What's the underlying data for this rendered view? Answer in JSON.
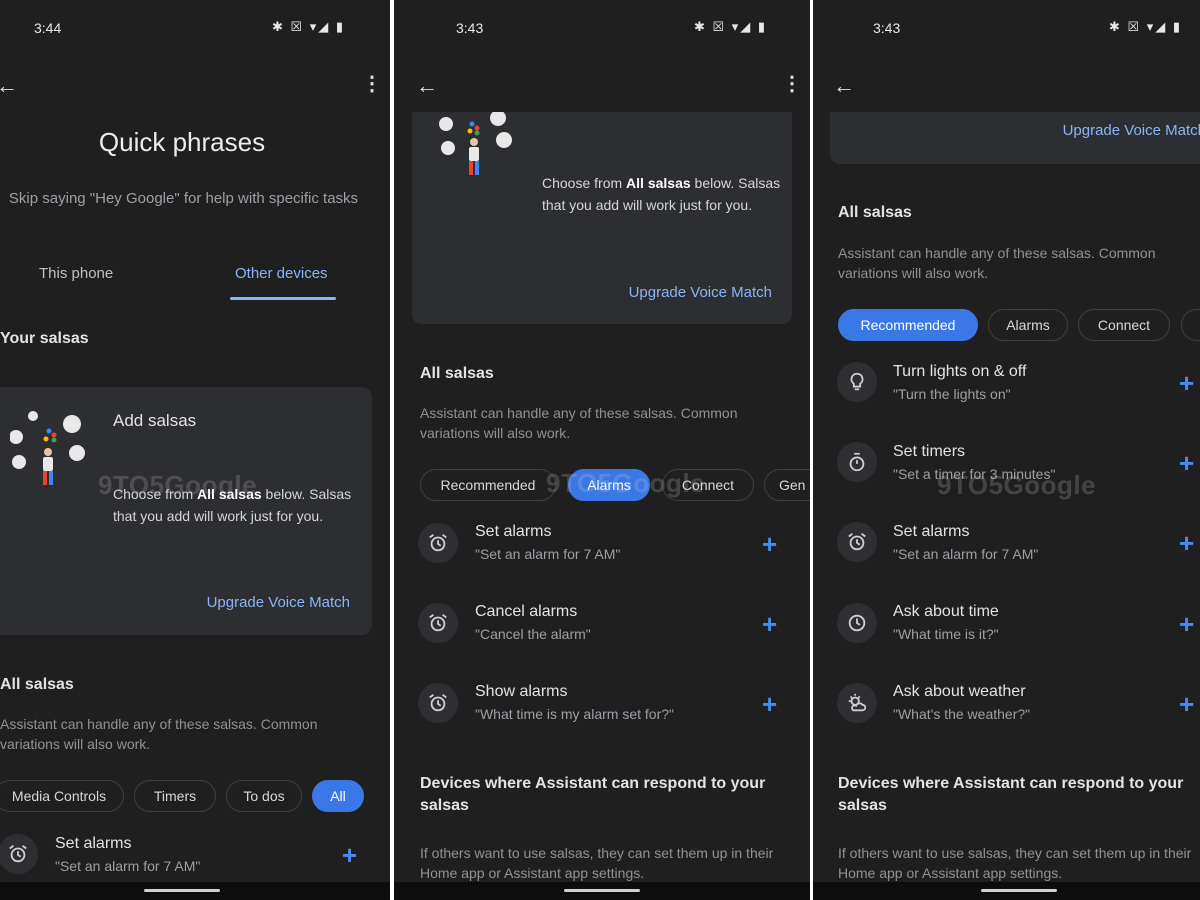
{
  "p1": {
    "time": "3:44",
    "status_icons": "✱ ☒ ▾◢ ▮",
    "title": "Quick phrases",
    "subtitle": "Skip saying \"Hey Google\" for help with specific tasks",
    "tabs": [
      {
        "label": "This phone",
        "active": false
      },
      {
        "label": "Other devices",
        "active": true
      }
    ],
    "your_salsas": "Your salsas",
    "card": {
      "title": "Add salsas",
      "text_pre": "Choose from ",
      "text_bold": "All salsas",
      "text_post": " below. Salsas that you add will work just for you.",
      "link": "Upgrade Voice Match"
    },
    "all_salsas": "All salsas",
    "all_desc": "Assistant can handle any of these salsas. Common variations will also work.",
    "chips": [
      {
        "label": "Media Controls",
        "active": false
      },
      {
        "label": "Timers",
        "active": false
      },
      {
        "label": "To dos",
        "active": false
      },
      {
        "label": "All",
        "active": true
      }
    ],
    "rows": [
      {
        "icon": "alarm-icon",
        "title": "Set alarms",
        "sub": "\"Set an alarm for 7 AM\""
      }
    ],
    "watermark": "9TO5Google"
  },
  "p2": {
    "time": "3:43",
    "status_icons": "✱ ☒ ▾◢ ▮",
    "card": {
      "text_pre": "Choose from ",
      "text_bold": "All salsas",
      "text_post": " below. Salsas that you add will work just for you.",
      "link": "Upgrade Voice Match"
    },
    "all_salsas": "All salsas",
    "all_desc": "Assistant can handle any of these salsas. Common variations will also work.",
    "chips": [
      {
        "label": "Recommended",
        "active": false
      },
      {
        "label": "Alarms",
        "active": true
      },
      {
        "label": "Connect",
        "active": false
      },
      {
        "label": "Gen",
        "active": false
      }
    ],
    "rows": [
      {
        "icon": "alarm-icon",
        "title": "Set alarms",
        "sub": "\"Set an alarm for 7 AM\""
      },
      {
        "icon": "alarm-icon",
        "title": "Cancel alarms",
        "sub": "\"Cancel the alarm\""
      },
      {
        "icon": "alarm-icon",
        "title": "Show alarms",
        "sub": "\"What time is my alarm set for?\""
      }
    ],
    "devices_heading": "Devices where Assistant can respond to your salsas",
    "devices_desc": "If others want to use salsas, they can set them up in their Home app or Assistant app settings.",
    "watermark": "9TO5Google"
  },
  "p3": {
    "time": "3:43",
    "status_icons": "✱ ☒ ▾◢ ▮",
    "card": {
      "link": "Upgrade Voice Match"
    },
    "all_salsas": "All salsas",
    "all_desc": "Assistant can handle any of these salsas. Common variations will also work.",
    "chips": [
      {
        "label": "Recommended",
        "active": true
      },
      {
        "label": "Alarms",
        "active": false
      },
      {
        "label": "Connect",
        "active": false
      }
    ],
    "rows": [
      {
        "icon": "lightbulb-icon",
        "title": "Turn lights on & off",
        "sub": "\"Turn the lights on\""
      },
      {
        "icon": "timer-icon",
        "title": "Set timers",
        "sub": "\"Set a timer for 3 minutes\""
      },
      {
        "icon": "alarm-icon",
        "title": "Set alarms",
        "sub": "\"Set an alarm for 7 AM\""
      },
      {
        "icon": "clock-icon",
        "title": "Ask about time",
        "sub": "\"What time is it?\""
      },
      {
        "icon": "weather-icon",
        "title": "Ask about weather",
        "sub": "\"What's the weather?\""
      }
    ],
    "devices_heading": "Devices where Assistant can respond to your salsas",
    "devices_desc": "If others want to use salsas, they can set them up in their Home app or Assistant app settings.",
    "watermark": "9TO5Google"
  },
  "colors": {
    "background": "#1f1f1f",
    "card": "#2d2e31",
    "accent": "#8ab4f8",
    "chip_active": "#3b78e7",
    "plus": "#4b8af5"
  }
}
